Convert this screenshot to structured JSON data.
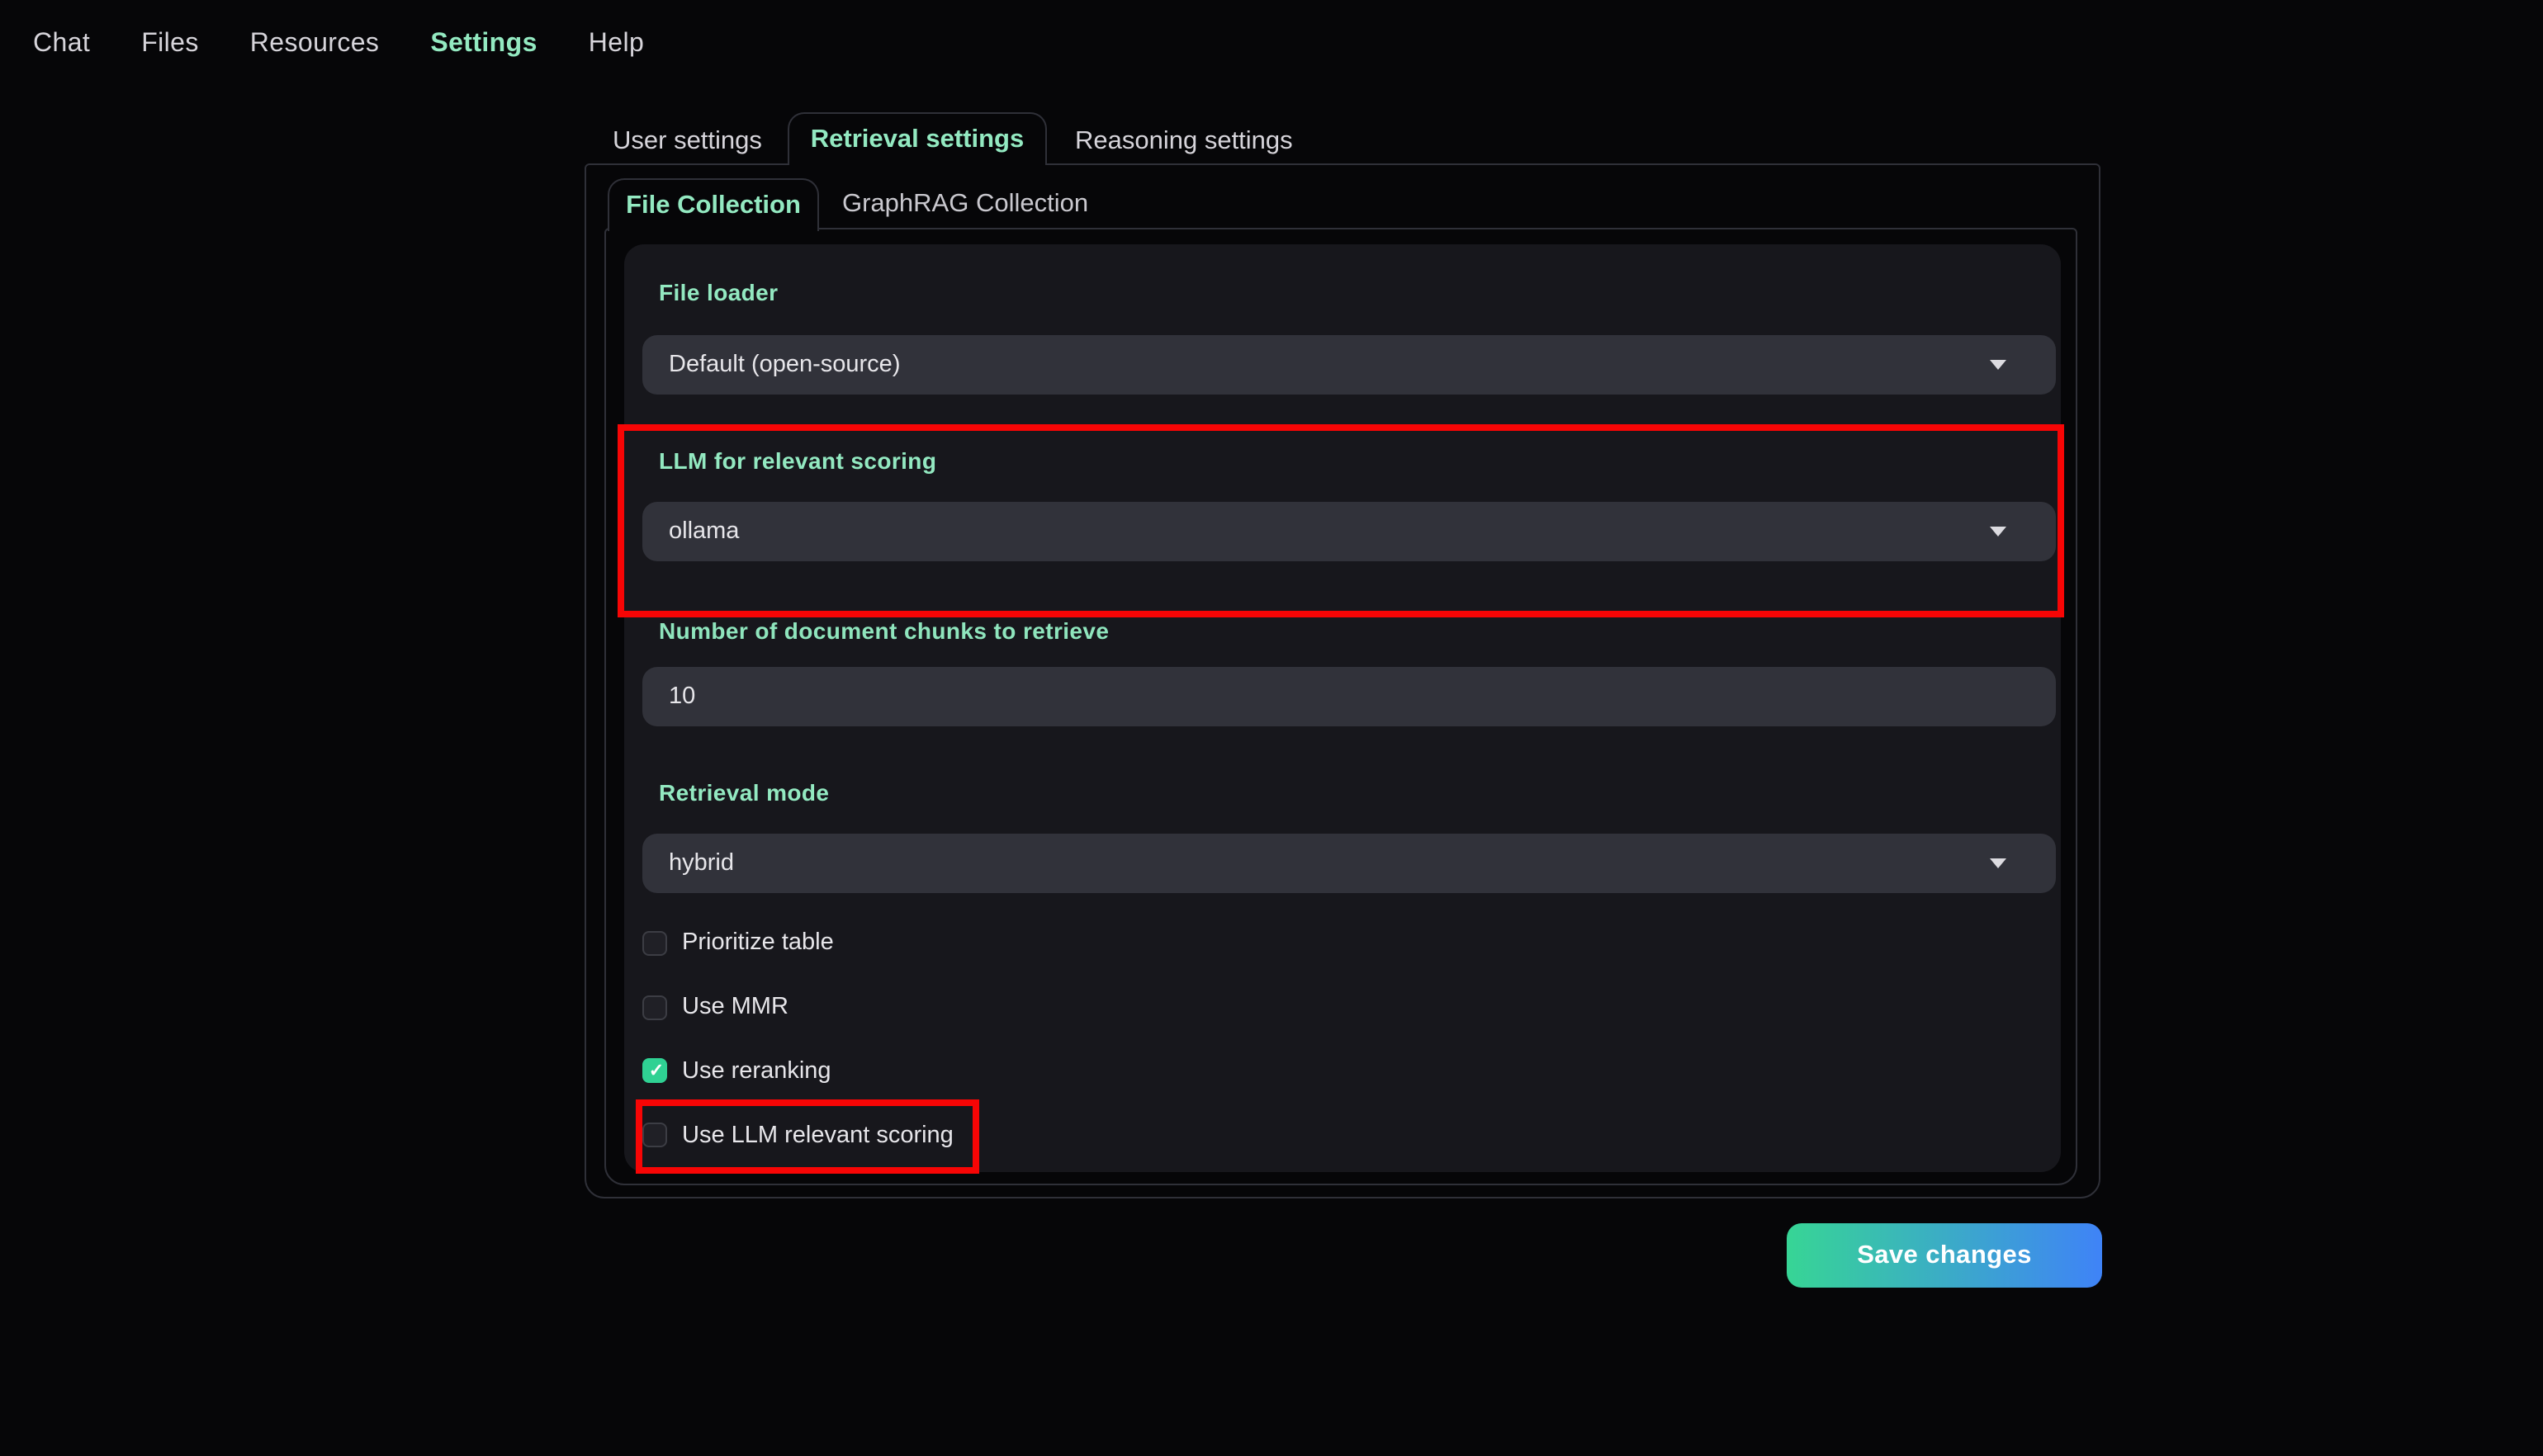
{
  "nav": {
    "items": [
      {
        "label": "Chat",
        "active": false
      },
      {
        "label": "Files",
        "active": false
      },
      {
        "label": "Resources",
        "active": false
      },
      {
        "label": "Settings",
        "active": true
      },
      {
        "label": "Help",
        "active": false
      }
    ]
  },
  "tabs": {
    "items": [
      {
        "label": "User settings",
        "active": false
      },
      {
        "label": "Retrieval settings",
        "active": true
      },
      {
        "label": "Reasoning settings",
        "active": false
      }
    ]
  },
  "subtabs": {
    "items": [
      {
        "label": "File Collection",
        "active": true
      },
      {
        "label": "GraphRAG Collection",
        "active": false
      }
    ]
  },
  "form": {
    "file_loader": {
      "label": "File loader",
      "value": "Default (open-source)"
    },
    "llm_scoring": {
      "label": "LLM for relevant scoring",
      "value": "ollama"
    },
    "num_chunks": {
      "label": "Number of document chunks to retrieve",
      "value": "10"
    },
    "retrieval_mode": {
      "label": "Retrieval mode",
      "value": "hybrid"
    },
    "checkboxes": [
      {
        "label": "Prioritize table",
        "checked": false
      },
      {
        "label": "Use MMR",
        "checked": false
      },
      {
        "label": "Use reranking",
        "checked": true
      },
      {
        "label": "Use LLM relevant scoring",
        "checked": false
      }
    ]
  },
  "actions": {
    "save_label": "Save changes"
  },
  "icons": {
    "check": "✓"
  },
  "colors": {
    "accent_teal": "#93e9c1",
    "highlight_red": "#f70505",
    "checkbox_green": "#2fd193",
    "button_gradient_start": "#37d595",
    "button_gradient_end": "#3f83f7",
    "panel_bg": "#17171c",
    "input_bg": "#31323a",
    "page_bg": "#060608"
  }
}
